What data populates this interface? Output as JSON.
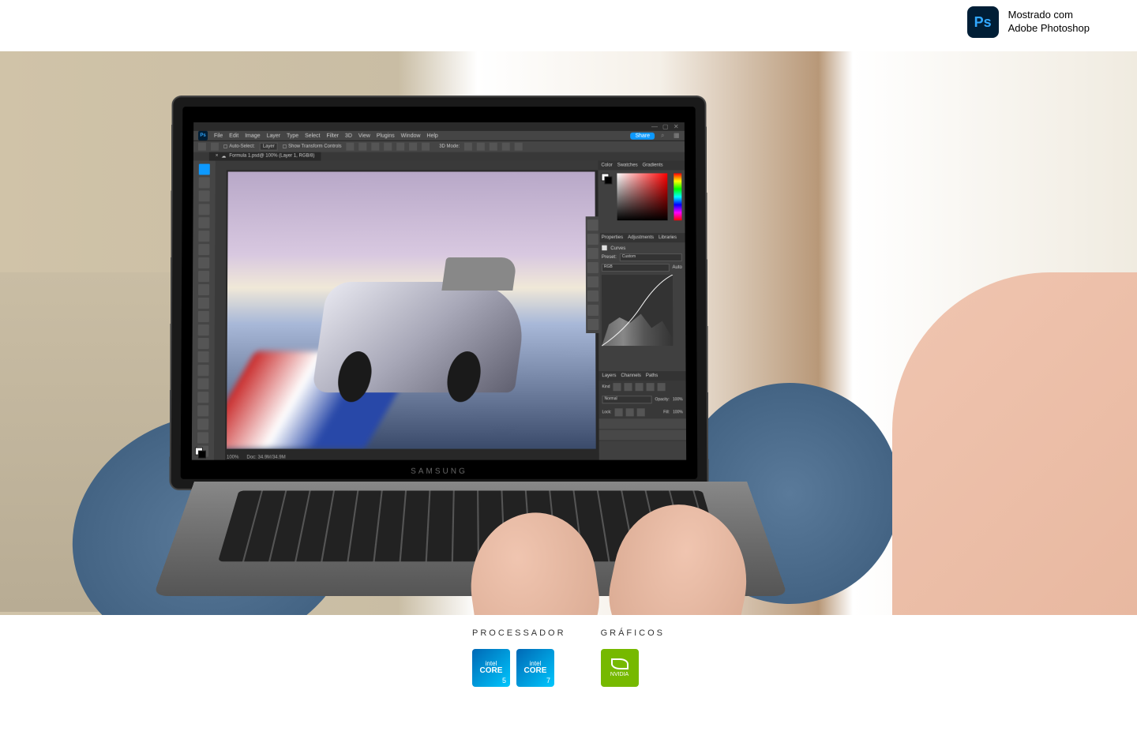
{
  "top_badge": {
    "icon_label": "Ps",
    "line1": "Mostrado com",
    "line2": "Adobe Photoshop"
  },
  "laptop": {
    "brand": "SAMSUNG"
  },
  "photoshop": {
    "menu": [
      "File",
      "Edit",
      "Image",
      "Layer",
      "Type",
      "Select",
      "Filter",
      "3D",
      "View",
      "Plugins",
      "Window",
      "Help"
    ],
    "share_label": "Share",
    "options_bar": {
      "auto_select": "Auto-Select:",
      "layer_dropdown": "Layer",
      "show_transform": "Show Transform Controls",
      "mode_label": "3D Mode:"
    },
    "document_tab": "Formula 1.psd@ 100% (Layer 1, RGB/8)",
    "status": {
      "zoom": "100%",
      "doc": "Doc: 34.9M/34.9M"
    },
    "panels": {
      "color_tabs": [
        "Color",
        "Swatches",
        "Gradients"
      ],
      "properties_tabs": [
        "Properties",
        "Adjustments",
        "Libraries"
      ],
      "curves_label": "Curves",
      "preset_label": "Preset:",
      "preset_value": "Custom",
      "channel_value": "RGB",
      "auto_label": "Auto",
      "layers_tabs": [
        "Layers",
        "Channels",
        "Paths"
      ],
      "layers": {
        "kind_label": "Kind",
        "blend_mode": "Normal",
        "opacity_label": "Opacity:",
        "opacity_value": "100%",
        "lock_label": "Lock:",
        "fill_label": "Fill:",
        "fill_value": "100%"
      }
    }
  },
  "specs": {
    "processor_title": "PROCESSADOR",
    "graphics_title": "GRÁFICOS",
    "intel": {
      "brand": "intel",
      "core": "CORE",
      "model_5": "5",
      "model_7": "7"
    },
    "nvidia": {
      "brand": "NVIDIA"
    }
  }
}
